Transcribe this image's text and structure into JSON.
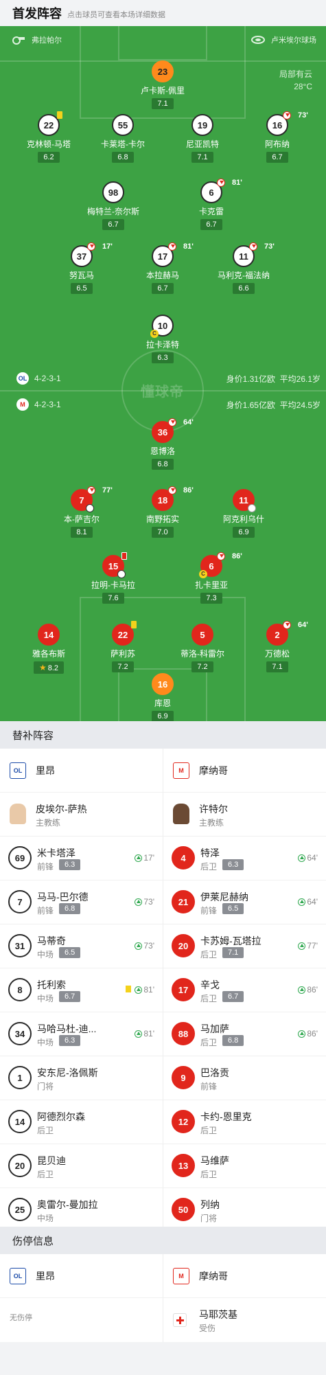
{
  "header": {
    "title": "首发阵容",
    "subtitle": "点击球员可查看本场详细数据"
  },
  "pitch": {
    "home_team": "弗拉帕尔",
    "stadium": "卢米埃尔球场",
    "weather": "局部有云",
    "temperature": "28°C",
    "watermark": "懂球帝",
    "home_formation": "4-2-3-1",
    "home_value": "身价1.31亿欧",
    "home_age": "平均26.1岁",
    "away_formation": "4-2-3-1",
    "away_value": "身价1.65亿欧",
    "away_age": "平均24.5岁"
  },
  "home_players": [
    {
      "num": "23",
      "name": "卢卡斯-佩里",
      "rating": "7.1"
    },
    {
      "num": "22",
      "name": "克林顿-马塔",
      "rating": "6.2"
    },
    {
      "num": "55",
      "name": "卡莱塔-卡尔",
      "rating": "6.8"
    },
    {
      "num": "19",
      "name": "尼亚凯特",
      "rating": "7.1"
    },
    {
      "num": "16",
      "name": "阿布纳",
      "rating": "6.7",
      "sub_time": "73'"
    },
    {
      "num": "98",
      "name": "梅特兰-奈尔斯",
      "rating": "6.7"
    },
    {
      "num": "6",
      "name": "卡克雷",
      "rating": "6.7",
      "sub_time": "81'"
    },
    {
      "num": "37",
      "name": "努瓦马",
      "rating": "6.5",
      "sub_time": "17'"
    },
    {
      "num": "17",
      "name": "本拉赫马",
      "rating": "6.7",
      "sub_time": "81'"
    },
    {
      "num": "11",
      "name": "马利克-福法纳",
      "rating": "6.6",
      "sub_time": "73'"
    },
    {
      "num": "10",
      "name": "拉卡泽特",
      "rating": "6.3"
    }
  ],
  "away_players": [
    {
      "num": "36",
      "name": "恩博洛",
      "rating": "6.8",
      "sub_time": "64'"
    },
    {
      "num": "7",
      "name": "本-萨吉尔",
      "rating": "8.1",
      "sub_time": "77'"
    },
    {
      "num": "18",
      "name": "南野拓实",
      "rating": "7.0",
      "sub_time": "86'"
    },
    {
      "num": "11",
      "name": "阿克利乌什",
      "rating": "6.9"
    },
    {
      "num": "15",
      "name": "拉明-卡马拉",
      "rating": "7.6"
    },
    {
      "num": "6",
      "name": "扎卡里亚",
      "rating": "7.3",
      "sub_time": "86'"
    },
    {
      "num": "14",
      "name": "雅各布斯",
      "rating": "8.2"
    },
    {
      "num": "22",
      "name": "萨利苏",
      "rating": "7.2"
    },
    {
      "num": "5",
      "name": "蒂洛-科雷尔",
      "rating": "7.2"
    },
    {
      "num": "2",
      "name": "万德松",
      "rating": "7.1",
      "sub_time": "64'"
    },
    {
      "num": "16",
      "name": "库恩",
      "rating": "6.9"
    }
  ],
  "subs": {
    "title": "替补阵容",
    "home_club": "里昂",
    "away_club": "摩纳哥",
    "home_coach": {
      "name": "皮埃尔-萨热",
      "role": "主教练"
    },
    "away_coach": {
      "name": "许特尔",
      "role": "主教练"
    },
    "home": [
      {
        "num": "69",
        "name": "米卡塔泽",
        "pos": "前锋",
        "rating": "6.3",
        "time": "17'"
      },
      {
        "num": "7",
        "name": "马马-巴尔德",
        "pos": "前锋",
        "rating": "6.8",
        "time": "73'"
      },
      {
        "num": "31",
        "name": "马蒂奇",
        "pos": "中场",
        "rating": "6.5",
        "time": "73'"
      },
      {
        "num": "8",
        "name": "托利索",
        "pos": "中场",
        "rating": "6.7",
        "time": "81'"
      },
      {
        "num": "34",
        "name": "马哈马杜-迪...",
        "pos": "中场",
        "rating": "6.3",
        "time": "81'"
      },
      {
        "num": "1",
        "name": "安东尼-洛佩斯",
        "pos": "门将"
      },
      {
        "num": "14",
        "name": "阿德烈尔森",
        "pos": "后卫"
      },
      {
        "num": "20",
        "name": "昆贝迪",
        "pos": "后卫"
      },
      {
        "num": "25",
        "name": "奥雷尔-曼加拉",
        "pos": "中场"
      }
    ],
    "away": [
      {
        "num": "4",
        "name": "特泽",
        "pos": "后卫",
        "rating": "6.3",
        "time": "64'"
      },
      {
        "num": "21",
        "name": "伊莱尼赫纳",
        "pos": "前锋",
        "rating": "6.5",
        "time": "64'"
      },
      {
        "num": "20",
        "name": "卡苏姆-瓦塔拉",
        "pos": "后卫",
        "rating": "7.1",
        "time": "77'"
      },
      {
        "num": "17",
        "name": "辛戈",
        "pos": "后卫",
        "rating": "6.7",
        "time": "86'"
      },
      {
        "num": "88",
        "name": "马加萨",
        "pos": "后卫",
        "rating": "6.8",
        "time": "86'"
      },
      {
        "num": "9",
        "name": "巴洛贡",
        "pos": "前锋"
      },
      {
        "num": "12",
        "name": "卡约-恩里克",
        "pos": "后卫"
      },
      {
        "num": "13",
        "name": "马维萨",
        "pos": "后卫"
      },
      {
        "num": "50",
        "name": "列纳",
        "pos": "门将"
      }
    ]
  },
  "injuries": {
    "title": "伤停信息",
    "home_club": "里昂",
    "away_club": "摩纳哥",
    "home_none": "无伤停",
    "away_player": {
      "name": "马耶茨基",
      "status": "受伤"
    }
  },
  "colors": {
    "pitch": "#3da244",
    "away": "#e1261c",
    "gk": "#ff8a1c",
    "sub_in": "#2fa84f"
  }
}
